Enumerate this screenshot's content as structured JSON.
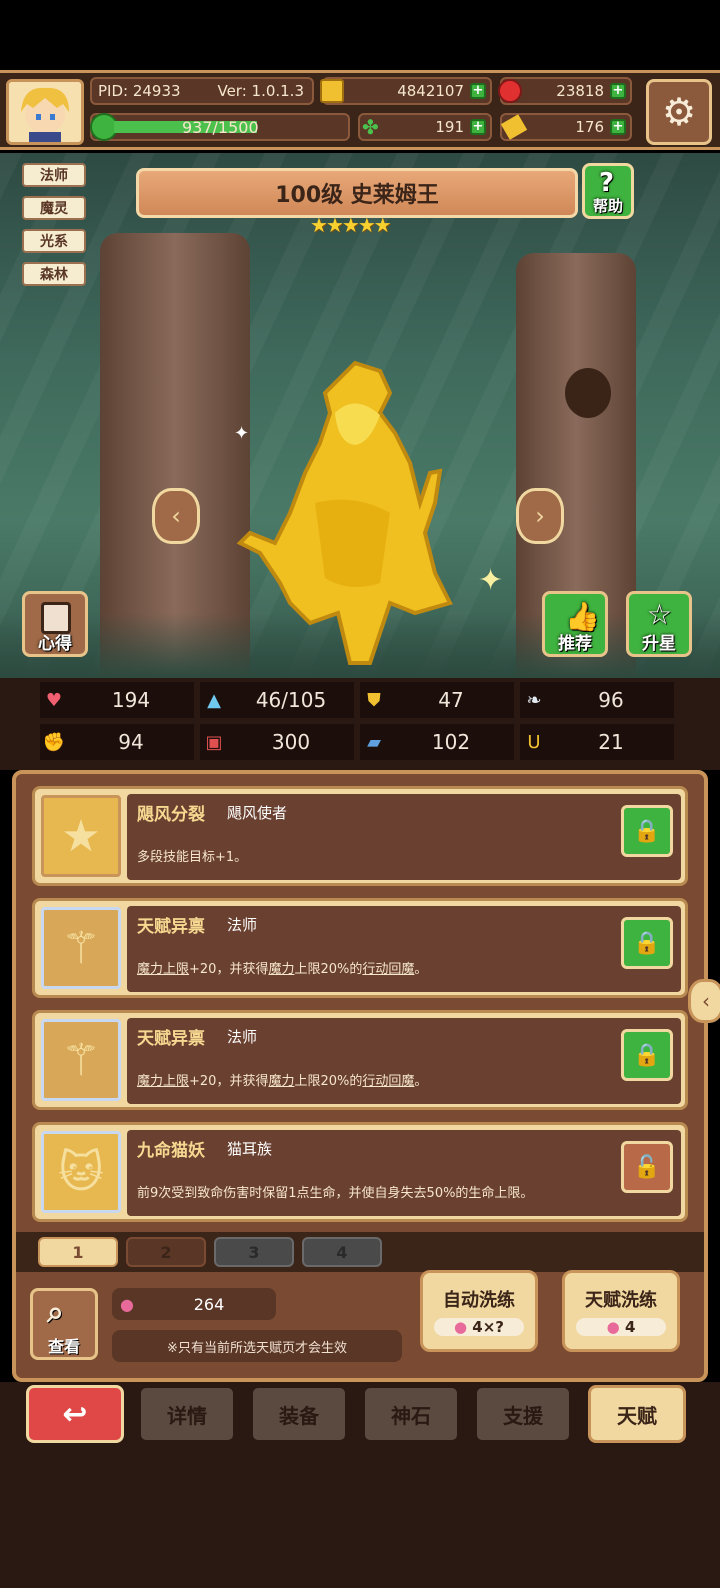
{
  "header": {
    "pid": "PID: 24933",
    "version": "Ver: 1.0.1.3",
    "exp": "937/1500",
    "exp_progress": 0.625,
    "gold": "4842107",
    "gems": "23818",
    "clover": "191",
    "tickets": "176"
  },
  "character": {
    "tags": [
      "法师",
      "魔灵",
      "光系",
      "森林"
    ],
    "title": "100级 史莱姆王",
    "stars": 5,
    "help_label": "帮助",
    "insight_label": "心得",
    "recommend_label": "推荐",
    "star_up_label": "升星"
  },
  "stats": [
    {
      "icon": "heart-icon",
      "value": "194"
    },
    {
      "icon": "mana-drop-icon",
      "value": "46/105"
    },
    {
      "icon": "shield-icon",
      "value": "47"
    },
    {
      "icon": "wing-icon",
      "value": "96"
    },
    {
      "icon": "fist-icon",
      "value": "94"
    },
    {
      "icon": "book-icon",
      "value": "300"
    },
    {
      "icon": "boot-icon",
      "value": "102"
    },
    {
      "icon": "horseshoe-icon",
      "value": "21"
    }
  ],
  "talents": [
    {
      "name": "飓风分裂",
      "sub": "飓风使者",
      "desc": "多段技能目标+1。",
      "locked": true,
      "icon": "star-icon"
    },
    {
      "name": "天赋异禀",
      "sub": "法师",
      "desc_parts": [
        "魔力上限",
        "+20，并获得",
        "魔力",
        "上限20%的",
        "行动回魔",
        "。"
      ],
      "locked": true,
      "icon": "staff-icon"
    },
    {
      "name": "天赋异禀",
      "sub": "法师",
      "desc_parts": [
        "魔力上限",
        "+20，并获得",
        "魔力",
        "上限20%的",
        "行动回魔",
        "。"
      ],
      "locked": true,
      "icon": "staff-icon"
    },
    {
      "name": "九命猫妖",
      "sub": "猫耳族",
      "desc": "前9次受到致命伤害时保留1点生命，并使自身失去50%的生命上限。",
      "locked": false,
      "icon": "cat-icon"
    }
  ],
  "pages": [
    "1",
    "2",
    "3",
    "4"
  ],
  "bottom": {
    "view_label": "查看",
    "potion_count": "264",
    "note": "※只有当前所选天赋页才会生效",
    "auto_reroll_label": "自动洗练",
    "auto_reroll_cost": "4×?",
    "reroll_label": "天赋洗练",
    "reroll_cost": "4"
  },
  "nav": [
    "详情",
    "装备",
    "神石",
    "支援",
    "天赋"
  ],
  "colors": {
    "accent": "#c8945a",
    "panel": "#7a4a32",
    "green": "#3fb33f",
    "return_red": "#e04848"
  }
}
